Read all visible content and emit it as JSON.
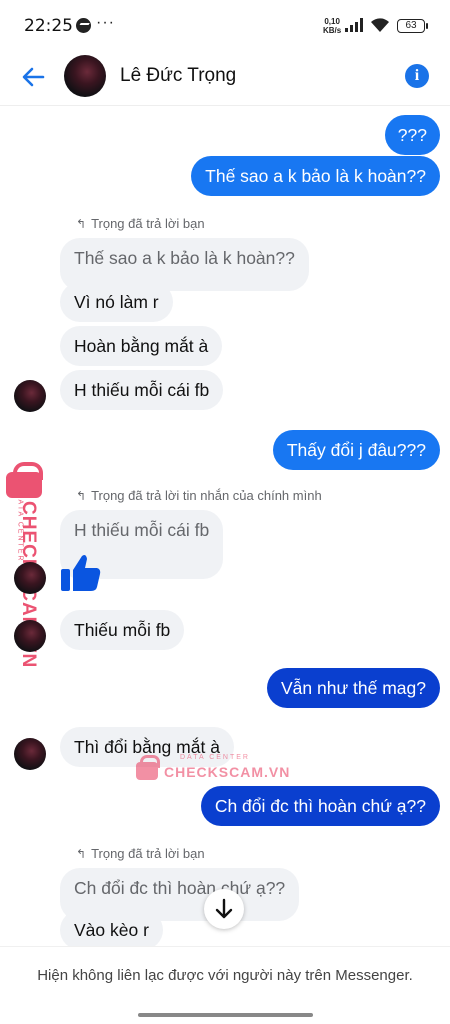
{
  "status_bar": {
    "time": "22:25",
    "more": "···",
    "speed_value": "0,10",
    "speed_unit": "KB/s",
    "battery": "63"
  },
  "header": {
    "contact_name": "Lê Đức Trọng"
  },
  "messages": [
    {
      "type": "out",
      "text": "???"
    },
    {
      "type": "out",
      "text": "Thế sao a k bảo là k hoàn??"
    },
    {
      "type": "reply_note",
      "text": "Trọng đã trả lời bạn"
    },
    {
      "type": "quoted",
      "text": "Thế sao a k bảo là k hoàn??"
    },
    {
      "type": "in",
      "text": "Vì nó làm r"
    },
    {
      "type": "in",
      "text": "Hoàn bằng mắt à"
    },
    {
      "type": "in",
      "text": "H thiếu mỗi cái fb"
    },
    {
      "type": "out",
      "text": "Thấy đổi j đâu???"
    },
    {
      "type": "reply_note",
      "text": "Trọng đã trả lời tin nhắn của chính mình"
    },
    {
      "type": "quoted",
      "text": "H thiếu mỗi cái fb"
    },
    {
      "type": "in",
      "text": "Thiếu mỗi fb"
    },
    {
      "type": "out",
      "text": "Vẫn như thế mag?"
    },
    {
      "type": "in",
      "text": "Thì đổi bằng mắt à"
    },
    {
      "type": "out",
      "text": "Ch đổi đc thì hoàn chứ ạ??"
    },
    {
      "type": "reply_note",
      "text": "Trọng đã trả lời bạn"
    },
    {
      "type": "quoted",
      "text": "Ch đổi đc thì hoàn chứ ạ??"
    },
    {
      "type": "in",
      "text": "Vào kèo r"
    }
  ],
  "watermark": {
    "brand": "CHECKSCAM.VN",
    "tagline": "DATA CENTER"
  },
  "footer": {
    "notice": "Hiện không liên lạc được với người này trên Messenger."
  },
  "colors": {
    "outgoing": "#1877f2",
    "outgoing_dark": "#0a3fcf",
    "incoming": "#f0f2f5",
    "accent": "#1a73e8",
    "watermark": "#e8365a"
  }
}
